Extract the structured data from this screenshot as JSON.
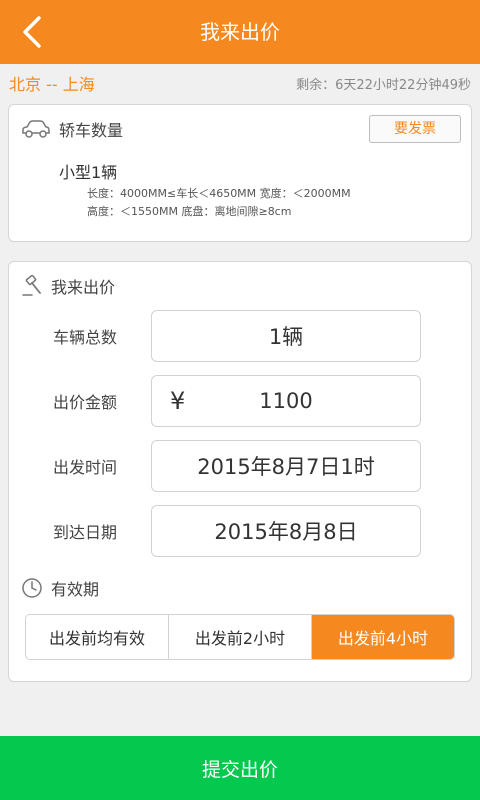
{
  "header": {
    "title": "我来出价",
    "back_icon": "chevron-left-icon"
  },
  "route": {
    "text": "北京 -- 上海",
    "remaining": "剩余：6天22小时22分钟49秒"
  },
  "vehicle": {
    "section_title": "轿车数量",
    "invoice_button": "要发票",
    "type_count": "小型1辆",
    "spec_line1": "长度：4000MM≤车长＜4650MM 宽度：＜2000MM",
    "spec_line2": "高度：＜1550MM 底盘：离地间隙≥8cm"
  },
  "bid": {
    "section_title": "我来出价",
    "total_label": "车辆总数",
    "total_value": "1辆",
    "amount_label": "出价金额",
    "currency": "¥",
    "amount_value": "1100",
    "depart_label": "出发时间",
    "depart_value": "2015年8月7日1时",
    "arrive_label": "到达日期",
    "arrive_value": "2015年8月8日"
  },
  "validity": {
    "title": "有效期",
    "options": [
      "出发前均有效",
      "出发前2小时",
      "出发前4小时"
    ],
    "selected": "出发前4小时"
  },
  "submit_label": "提交出价",
  "colors": {
    "accent": "#f5891f",
    "submit": "#05c84f"
  }
}
